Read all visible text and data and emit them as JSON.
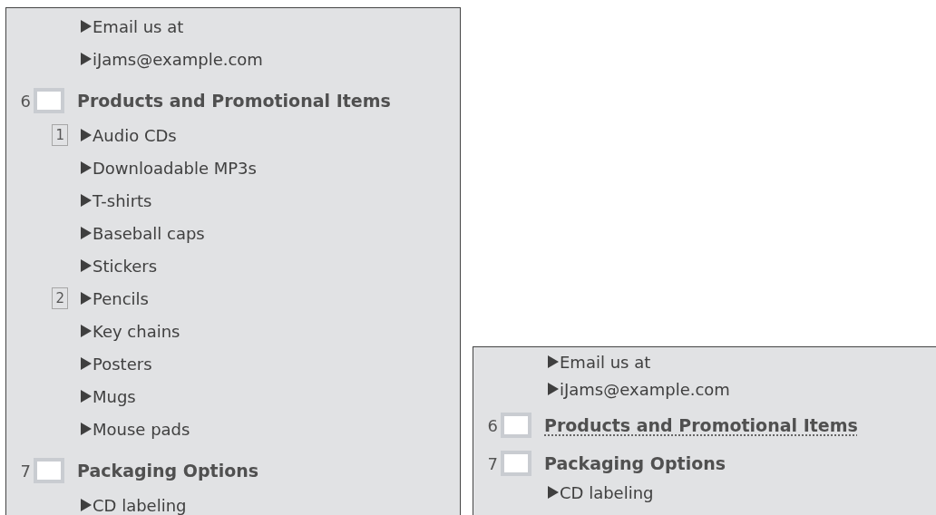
{
  "panels": [
    {
      "leading_bullets": [
        "Email us at",
        "iJams@example.com"
      ],
      "slides": [
        {
          "number": "6",
          "title": "Products and Promotional Items",
          "spelling_flag": false,
          "placeholders": [
            {
              "label": "1",
              "bullets": [
                "Audio CDs",
                "Downloadable MP3s",
                "T-shirts",
                "Baseball caps",
                "Stickers"
              ]
            },
            {
              "label": "2",
              "bullets": [
                "Pencils",
                "Key chains",
                "Posters",
                "Mugs",
                "Mouse pads"
              ]
            }
          ]
        },
        {
          "number": "7",
          "title": "Packaging Options",
          "spelling_flag": false,
          "placeholders": [
            {
              "bullets": [
                "CD labeling"
              ]
            }
          ]
        }
      ]
    },
    {
      "leading_bullets": [
        "Email us at",
        "iJams@example.com"
      ],
      "slides": [
        {
          "number": "6",
          "title": "Products and Promotional Items",
          "spelling_flag": true
        },
        {
          "number": "7",
          "title": "Packaging Options",
          "spelling_flag": false,
          "placeholders": [
            {
              "bullets": [
                "CD labeling"
              ]
            }
          ]
        }
      ]
    }
  ]
}
